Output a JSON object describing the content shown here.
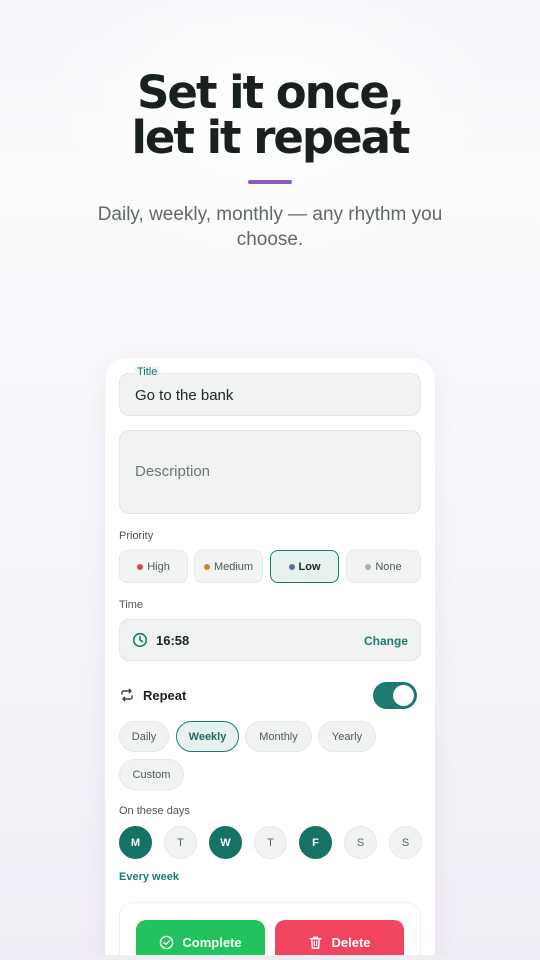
{
  "hero": {
    "headline_line1": "Set it once,",
    "headline_line2": "let it repeat",
    "subtitle": "Daily, weekly, monthly — any rhythm you choose.",
    "accent_color": "#8a5cb8"
  },
  "form": {
    "title_label": "Title",
    "title_value": "Go to the bank",
    "description_placeholder": "Description",
    "priority_label": "Priority",
    "priorities": [
      {
        "label": "High",
        "color": "#e0455c",
        "selected": false
      },
      {
        "label": "Medium",
        "color": "#c8862b",
        "selected": false
      },
      {
        "label": "Low",
        "color": "#5b7191",
        "selected": true
      },
      {
        "label": "None",
        "color": "#a7adab",
        "selected": false
      }
    ],
    "time_label": "Time",
    "time_value": "16:58",
    "time_change": "Change",
    "repeat_label": "Repeat",
    "repeat_enabled": true,
    "frequencies": [
      {
        "label": "Daily",
        "selected": false
      },
      {
        "label": "Weekly",
        "selected": true
      },
      {
        "label": "Monthly",
        "selected": false
      },
      {
        "label": "Yearly",
        "selected": false
      },
      {
        "label": "Custom",
        "selected": false
      }
    ],
    "days_label": "On these days",
    "days": [
      {
        "label": "M",
        "selected": true
      },
      {
        "label": "T",
        "selected": false
      },
      {
        "label": "W",
        "selected": true
      },
      {
        "label": "T",
        "selected": false
      },
      {
        "label": "F",
        "selected": true
      },
      {
        "label": "S",
        "selected": false
      },
      {
        "label": "S",
        "selected": false
      }
    ],
    "repeat_summary": "Every week"
  },
  "actions": {
    "complete_label": "Complete",
    "delete_label": "Delete"
  },
  "colors": {
    "primary": "#1c7a6f",
    "complete": "#22c35e",
    "delete": "#f1455f"
  }
}
